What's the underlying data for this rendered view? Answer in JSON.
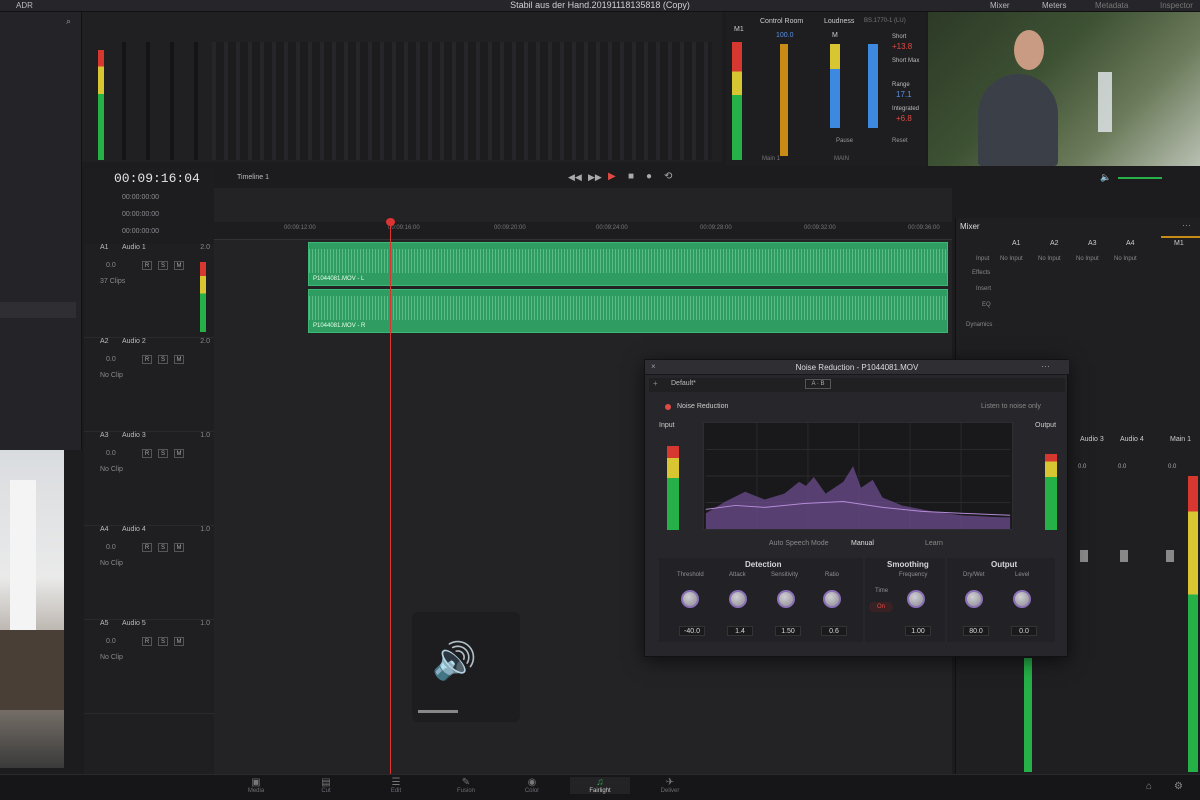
{
  "topbar": {
    "title": "Stabil aus der Hand.20191118135818 (Copy)",
    "left_label": "ADR",
    "tabs": [
      "Mixer",
      "Meters",
      "Metadata",
      "Inspector"
    ]
  },
  "timeline": {
    "timecode": "00:09:16:04",
    "tc_rows": [
      "00:00:00:00",
      "00:00:00:00",
      "00:00:00:00"
    ],
    "name": "Timeline 1",
    "ruler": [
      "00:09:12:00",
      "00:09:16:00",
      "00:09:20:00",
      "00:09:24:00",
      "00:09:28:00",
      "00:09:32:00",
      "00:09:36:00"
    ],
    "clips": [
      "P1044081.MOV - L",
      "P1044081.MOV - R"
    ]
  },
  "tracks": [
    {
      "num": "A1",
      "name": "Audio 1",
      "ch": "2.0",
      "vol": "0.0",
      "info": "37 Clips"
    },
    {
      "num": "A2",
      "name": "Audio 2",
      "ch": "2.0",
      "vol": "0.0",
      "info": "No Clip"
    },
    {
      "num": "A3",
      "name": "Audio 3",
      "ch": "1.0",
      "vol": "0.0",
      "info": "No Clip"
    },
    {
      "num": "A4",
      "name": "Audio 4",
      "ch": "1.0",
      "vol": "0.0",
      "info": "No Clip"
    },
    {
      "num": "A5",
      "name": "Audio 5",
      "ch": "1.0",
      "vol": "0.0",
      "info": "No Clip"
    }
  ],
  "control_room": {
    "title": "Control Room",
    "loudness": "Loudness",
    "loud_std": "BS.1770-1 (LU)",
    "level": "100.0",
    "m_label": "M1",
    "short": "Short",
    "short_val": "+13.8",
    "short_max": "Short Max",
    "range": "Range",
    "range_val": "17.1",
    "integrated": "Integrated",
    "integrated_val": "+6.8",
    "pause": "Pause",
    "reset": "Reset",
    "main_left": "Main 1",
    "main_right": "MAIN"
  },
  "mixer": {
    "title": "Mixer",
    "columns": [
      "A1",
      "A2",
      "A3",
      "A4",
      "M1"
    ],
    "input_label": "Input",
    "input_vals": [
      "No Input",
      "No Input",
      "No Input",
      "No Input"
    ],
    "effects": "Effects",
    "inserts": "Insert",
    "eq": "EQ",
    "dynamics": "Dynamics",
    "lower_names": [
      "Audio 3",
      "Audio 4",
      "Main 1"
    ],
    "lower_vals": [
      "0.0",
      "0.0",
      "0.0"
    ]
  },
  "noise_reduction": {
    "title": "Noise Reduction - P1044081.MOV",
    "preset": "Default*",
    "plugin_label": "Noise Reduction",
    "listen": "Listen to noise only",
    "input": "Input",
    "output": "Output",
    "modes": [
      "Auto Speech Mode",
      "Manual",
      "Learn"
    ],
    "detection": "Detection",
    "smoothing": "Smoothing",
    "output_section": "Output",
    "knobs": [
      {
        "label": "Threshold",
        "value": "-40.0"
      },
      {
        "label": "Attack",
        "value": "1.4"
      },
      {
        "label": "Sensitivity",
        "value": "1.50"
      },
      {
        "label": "Ratio",
        "value": "0.6"
      },
      {
        "label": "Frequency",
        "value": "1.00"
      },
      {
        "label": "Dry/Wet",
        "value": "80.0"
      },
      {
        "label": "Level",
        "value": "0.0"
      }
    ],
    "time_label": "Time",
    "time_on": "On"
  },
  "pages": [
    "Media",
    "Cut",
    "Edit",
    "Fusion",
    "Color",
    "Fairlight",
    "Deliver"
  ],
  "colors": {
    "accent": "#2f9c62",
    "playhead": "#d33333",
    "knob_ring": "#8b6fb7"
  }
}
